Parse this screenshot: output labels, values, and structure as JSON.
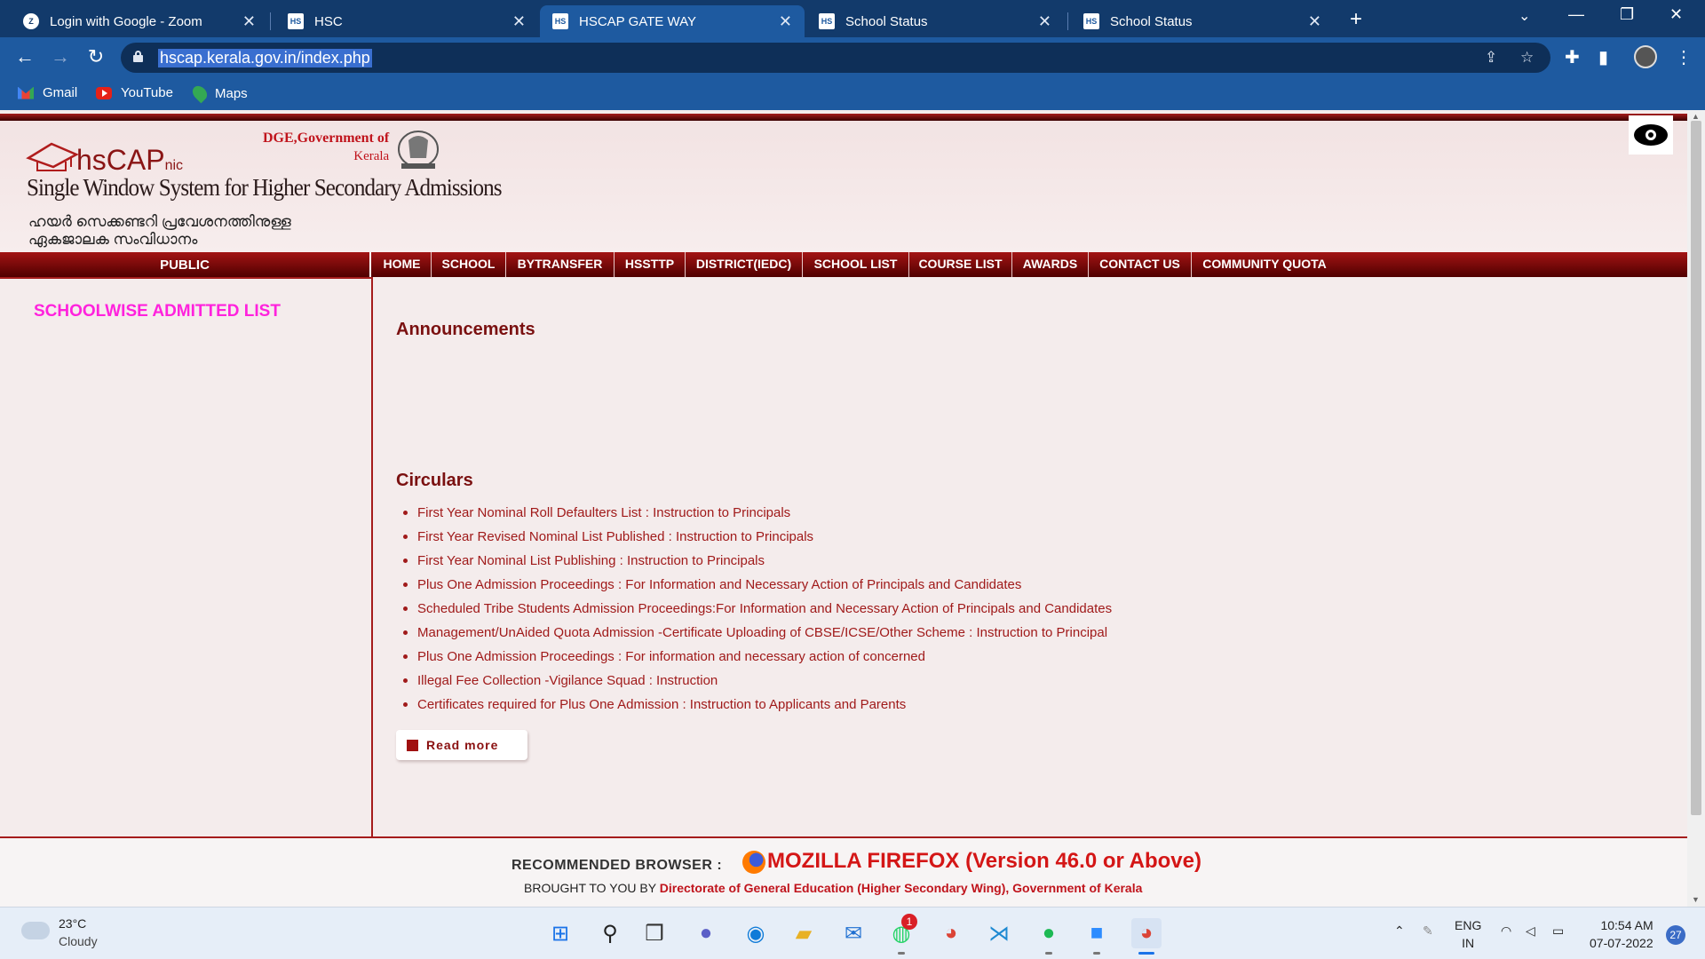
{
  "browser": {
    "tabs": [
      {
        "title": "Login with Google - Zoom",
        "favicon": "zoom-icon"
      },
      {
        "title": "HSC",
        "favicon": "hs-icon"
      },
      {
        "title": "HSCAP GATE WAY",
        "favicon": "hs-icon",
        "active": true
      },
      {
        "title": "School Status",
        "favicon": "hs-icon"
      },
      {
        "title": "School Status",
        "favicon": "hs-icon"
      }
    ],
    "url": "hscap.kerala.gov.in/index.php",
    "bookmarks": [
      {
        "label": "Gmail"
      },
      {
        "label": "YouTube"
      },
      {
        "label": "Maps"
      }
    ]
  },
  "header": {
    "logo_text": "hsCAP",
    "logo_sub": "nic",
    "dge_line1": "DGE,Government of",
    "dge_line2": "Kerala",
    "title": "Single Window System for Higher Secondary Admissions",
    "mal_line1": "ഹയർ സെക്കണ്ടറി പ്രവേശനത്തിനുള്ള",
    "mal_line2": "ഏകജാലക സംവിധാനം"
  },
  "nav": {
    "public": "PUBLIC",
    "items": [
      "HOME",
      "SCHOOL",
      "BYTRANSFER",
      "HSSTTP",
      "DISTRICT(IEDC)",
      "SCHOOL LIST",
      "COURSE LIST",
      "AWARDS",
      "CONTACT US",
      "COMMUNITY QUOTA"
    ]
  },
  "sidebar": {
    "link": "SCHOOLWISE ADMITTED LIST"
  },
  "content": {
    "announcements_title": "Announcements",
    "circulars_title": "Circulars",
    "circulars": [
      "First Year Nominal Roll Defaulters List : Instruction to Principals",
      "First Year Revised Nominal List Published : Instruction to Principals",
      "First Year Nominal List Publishing : Instruction to Principals",
      "Plus One Admission Proceedings : For Information and Necessary Action of Principals and Candidates",
      "Scheduled Tribe Students Admission Proceedings:For Information and Necessary Action of Principals and Candidates",
      "Management/UnAided Quota Admission -Certificate Uploading of CBSE/ICSE/Other Scheme : Instruction to Principal",
      "Plus One Admission Proceedings : For information and necessary action of concerned",
      "Illegal Fee Collection -Vigilance Squad : Instruction",
      "Certificates required for Plus One Admission : Instruction to Applicants and Parents"
    ],
    "read_more": "Read more"
  },
  "footer": {
    "recommended_label": "RECOMMENDED BROWSER :",
    "browser": "MOZILLA FIREFOX (Version 46.0 or Above)",
    "brought_prefix": "BROUGHT TO YOU BY",
    "brought_org": "Directorate of General Education (Higher Secondary Wing), Government of Kerala"
  },
  "taskbar": {
    "temperature": "23°C",
    "weather": "Cloudy",
    "whatsapp_badge": "1",
    "lang1": "ENG",
    "lang2": "IN",
    "time": "10:54 AM",
    "date": "07-07-2022",
    "notifications": "27"
  }
}
